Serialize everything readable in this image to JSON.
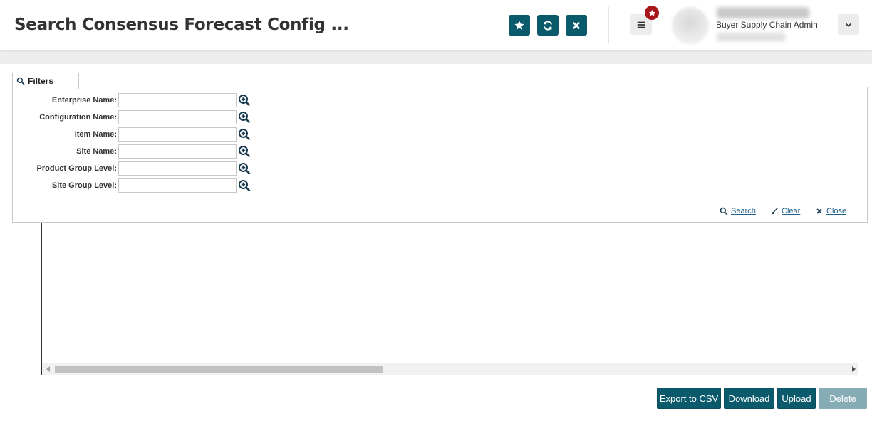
{
  "header": {
    "title": "Search Consensus Forecast Config ...",
    "buttons": {
      "favorite_icon": "star-icon",
      "refresh_icon": "refresh-icon",
      "close_icon": "close-icon"
    },
    "menu_icon": "hamburger-menu-icon",
    "notification_icon": "star-badge-icon",
    "user": {
      "role": "Buyer Supply Chain Admin"
    },
    "dropdown_icon": "chevron-down-icon"
  },
  "filters": {
    "tab_label": "Filters",
    "fields": [
      {
        "label": "Enterprise Name:",
        "value": ""
      },
      {
        "label": "Configuration Name:",
        "value": ""
      },
      {
        "label": "Item Name:",
        "value": ""
      },
      {
        "label": "Site Name:",
        "value": ""
      },
      {
        "label": "Product Group Level:",
        "value": ""
      },
      {
        "label": "Site Group Level:",
        "value": ""
      }
    ],
    "actions": {
      "search": "Search",
      "clear": "Clear",
      "close": "Close"
    }
  },
  "footer": {
    "export_csv": "Export to CSV",
    "download": "Download",
    "upload": "Upload",
    "delete": "Delete"
  },
  "colors": {
    "primary": "#0b5a6c",
    "primary_disabled": "#86adb6",
    "badge": "#a8151a",
    "link": "#1f5f8b"
  }
}
